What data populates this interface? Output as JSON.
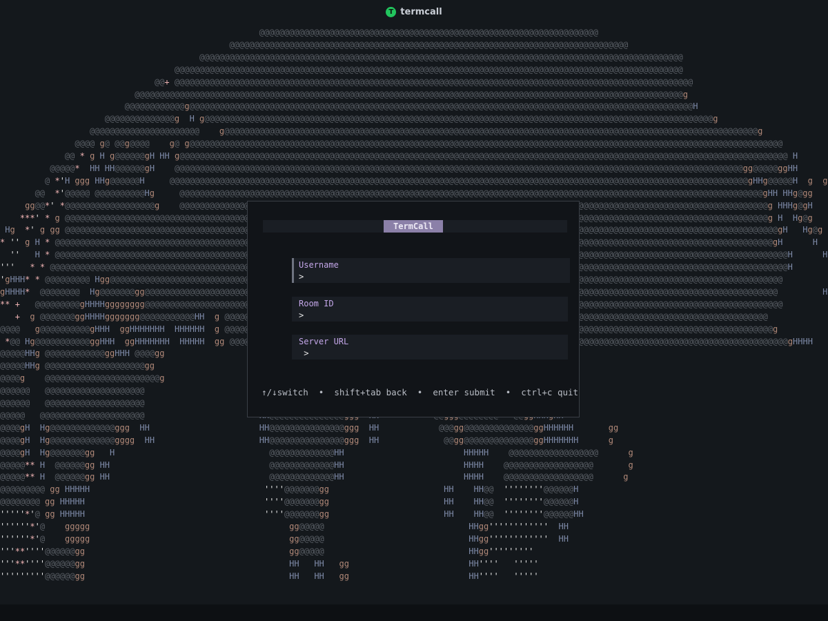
{
  "window": {
    "title": "termcall",
    "logo_letter": "T"
  },
  "colors": {
    "logo": "#22c55e",
    "title_badge": "#8b80a8",
    "field_label": "#c3a6e8",
    "art_at": "#5a5f66",
    "art_g": "#b08878",
    "art_h": "#7e8aa8"
  },
  "dialog": {
    "title": "TermCall",
    "fields": [
      {
        "label": "Username",
        "value": ">",
        "active": true
      },
      {
        "label": "Room ID",
        "value": ">",
        "active": false
      },
      {
        "label": "Server URL",
        "value": " >",
        "active": false
      }
    ],
    "help": "↑/↓switch  •  shift+tab back  •  enter submit  •  ctrl+c quit"
  },
  "background_art": {
    "description_visible": "ASCII art backdrop rendered in @ g H w ' , * + characters",
    "rows": [
      "                                                    @@@@@@@@@@@@@@@@@@@@@@@@@@@@@@@@@@@@@@@@@@@@@@@@@@@@@@@@@@@@@@@@@@@@",
      "                                              @@@@@@@@@@@@@@@@@@@@@@@@@@@@@@@@@@@@@@@@@@@@@@@@@@@@@@@@@@@@@@@@@@@@@@@@@@@@@@@@",
      "                                        @@@@@@@@@@@@@@@@@@@@@@@@@@@@@@@@@@@@@@@@@@@@@@@@@@@@@@@@@@@@@@@@@@@@@@@@@@@@@@@@@@@@@@@@@@@@@@@@@",
      "                                   @@@@@@@@@@@@@@@@@@@@@@@@@@@@@@@@@@@@@@@@@@@@@@@@@@@@@@@@@@@@@@@@@@@@@@@@@@@@@@@@@@@@@@@@@@@@@@@@@@@@@@",
      "                               @@+ @@@@@@@@@@@@@@@@@@@@@@@@@@@@@@@@@@@@@@@@@@@@@@@@@@@@@@@@@@@@@@@@@@@@@@@@@@@@@@@@@@@@@@@@@@@@@@@@@@@@@@@@",
      "                           @@@@@@@@@@@@@@@@@@@@@@@@@@@@@@@@@@@@@@@@@@@@@@@@@@@@@@@@@@@@@@@@@@@@@@@@@@@@@@@@@@@@@@@@@@@@@@@@@@@@@@@@@@@@@@g",
      "                         @@@@@@@@@@@@g@@@@@@@@@@@@@@@@@@@@@@@@@@@@@@@@@@@@@@@@@@@@@@@@@@@@@@@@@@@@@@@@@@@@@@@@@@@@@@@@@@@@@@@@@@@@@@@@@@@@@H",
      "                     @@@@@@@@@@@@@@g  H g@@@@@@@@@@@@@@@@@@@@@@@@@@@@@@@@@@@@@@@@@@@@@@@@@@@@@@@@@@@@@@@@@@@@@@@@@@@@@@@@@@@@@@@@@@@@@@@@@@@@@@g",
      "                  @@@@@@@@@@@@@@@@@@@@@@    g@@@@@@@@@@@@@@@@@@@@@@@@@@@@@@@@@@@@@@@@@@@@@@@@@@@@@@@@@@@@@@@@@@@@@@@@@@@@@@@@@@@@@@@@@@@@@@@@@@@@@@@@@@@g",
      "               @@@@ g@ @@g@@@@    g@ g@@@@@@@@@@@@@@@@@@@@@@@@@@@@@@@@@@@@@@@@@@@@@@@@@@@@@@@@@@@@@@@@@@@@@@@@@@@@@@@@@@@@@@@@@@@@@@@@@@@@@@@@@@@@@@@@@@@@@@@",
      "             @@ * g H g@@@@@@gH HH g@@@@@@@@@@@@@@@@@@@@@@@@@@@@@@@@@@@@@@@@@@@@@@@@@@@@@@@@@@@@@@@@@@@@@@@@@@@@@@@@@@@@@@@@@@@@@@@@@@@@@@@@@@@@@@@@@@@@@@@@@@ H",
      "          @@@@@*  HH HH@@@@@@gH    @@@@@@@@@@@@@@@@@@@@@@@@@@@@@@@@@@@@@@@@@@@@@@@@@@@@@@@@@@@@@@@@@@@@@@@@@@@@@@@@@@@@@@@@@@@@@@@@@@@@@@@@@@@@@@@@@@gg@@@@@ggHH",
      "         @ *'H ggg HHg@@@@@@H     @@@@@@@@@@@@@@@@@@@@@@@@@@@@@@@@@@@@@@@@@@@@@@@@@@@@@@@@@@@@@@@@@@@@@@@@@@@@@@@@@@@@@@@@@@@@@@@@@@@@@@@@@@@@@@@@@@@@gHHg@@@@@H  g  g",
      "       @@  *'@@@@@ @@@@@@@@@@Hg     @@@@@@@@@@@@@@@@@@@@@@@@@@@@@@@@@@@@@@@@@@@@@@@@@@@@@@@@@@@@@@@@@@@@@@@@@@@@@@@@@@@@@@@@@@@@@@@@@@@@@@@@@@@@@@@@@@@@@gHH HHg@gg    H",
      "     gg@@*' *@@@@@@@@@@@@@@@@@@g    @@@@@@@@@@@@@@@@@@@@@@@@@@@@@@@@@@@@@@@@@@@@@@@@@@@@@@@@@@@@@@@@@@@@@@@@@@@@@@@@@@@@@@@@@@@@@@@@@@@@@@@@@@@@@@@@@@@@@@g HHHg@gH     gHH",
      "    ***' * g @@@@@@@@@@@@@@@@@@@@@@@@@@@@@@@@@@@@@@@@@@@@@@@@@@@@@@@@@@@@@@@@@@@@@@@@@@@@@@@@@@@@@@@@@@@@@@@@@@@@@@@@@@@@@@@@@@@@@@@@@@@@@@@@@@@@@@@@@@@@@g H  Hg@g      H",
      " Hg  *' g gg @@@@@@@@@@@@@@@@@@@@@@@@@@@@@@@@@@@@@@@@@@@@@@@@@@@@@@@@@@@@@@@@@@@@@@@@@@@@@@@@@@@@@@@@@@@@@@@@@@@@@@@@@@@@@@@@@@@@@@@@@@@@@@@@@@@@@@@@@@@@@@@gH   Hg@g  HH  H",
      "* '' g H * @@@@@@@@@@@@@@@@@@@@@@@@@@@@@@@@@@@@@@@@@@@@@@@@@@@@@@@@@@@@@@@@@@@@@@@@@@@@@@@@@@@@@@@@@@@@@@@@@@@@@@@@@@@@@@@@@@@@@@@@@@@@@@@@@@@@@@@@@@@@@@@@gH      H  HHg@",
      "  ''   H * @@@@@@@@@@@@@@@@@@@@@@@@@@@@@@@@@@@@@@@@@@@@@@@@@@@@@@@@@@@@@@@@@@@@@@@@@@@@@@@@@@@@@@@@@@@@@@@@@@@@@@@@@@@@@@@@@@@@@@@@@@@@@@@@@@@@@@@@@@@@@@@@@@@H      H ggg @",
      "'''   * * @@@@@@@@@@@@@@@@@@@@@@@@@@@@@@@@@@@@@@@@@@@@@@@@@@@@@@@@@@@@@@@@@@@@@@@@@@@@@@@@@@@@@@@@@@@@@@@@@@@@@@@@@@@@@@@@@@@@@@@@@@@@@@@@@@@@@@@@@@@@@@@@@@@@H         g g H",
      "'gHHH* * @@@@@@@@@ Hgg@@@@@@@@@@@@@@@@@@@@@@@@@@@@@@@@@@@@@@@@@@@@@@@@@@@@@@@@@@@@@@@@@@@@@@@@@@@@@@@@@@@@@@@@@@@@@@@@@@@@@@@@@@@@@@@@@@@@@@@@@@@@@@@@@@@@@@@",
      "gHHHH*  @@@@@@@@  Hg@@@@@@@gg@@@@@@@@@@@@@@@@@@@@@@@@@@@@@@@@@@@@@@@@@@@@@@@@@@@@@@@@@@@@@@@@@@@@@@@@@@@@@@@@@@@@@@@@@@@@@@@@@@@@@@@@@@@@@@@@@@@@@@@@@@@@@@@         H",
      "** +   @@@@@@@@@gHHHHgggggggg@@@@@@@@@@@@@@@@@@@@@@@@@@@@@@@@@@@@@@@@@@@@@@@@@@@@@@@@@@@@@@@@@@@@@@@@@@@@@@@@@@@@@@@@@@@@@@@@@@@@@@@@@@@@@@@@@@@@@@@@@@@@@@@@",
      "   +  g @@@@@@@ggHHHHggggggg@@@@@@@@@@@HH  g @@@@@@@@@@@@@@@@@@@@@@@@@@@@@@@@@@@@@@@@@@@@@@@@@@@@@@@@@@@@@@@@@@@@@@@@@@@@@@@@@@@@@@@@@@@@@@@@@@@@@@@@@@@@@",
      "@@@@   g@@@@@@@@@@gHHH  ggHHHHHHH  HHHHHH  g @@@@@@@@@@@@@@@@@@@@@@@@@@@@@@@@@@@@@@@@@@@@@@@@@@@@@@@@@@@@@@@@@@@@@@@@@@@@@@@@@@@@@@@@@@@@@@@@@@@@@@@@@@@@@@g",
      " *@@ Hg@@@@@@@@@@@ggHHH  ggHHHHHHH  HHHHH  gg @@@@@@@@@@@@@@@@@@@@@@@@@@@@@@@@@@@@@@@@@@@@@@@@@@@@@@@@@@@@@@@@@@@@@@@@@@@@@@@@@@@@@@@@@@@@@@@@@@@@@@@@@@@@@@@@gHHHH",
      "@@@@@HHg @@@@@@@@@@@@ggHHH @@@@gg                                                            g@@@@@@@@@@@gHHHH",
      "@@@@@HHg @@@@@@@@@@@@@@@@@@@@gg                                                                gg@ggggg   HH",
      "@@@@g    @@@@@@@@@@@@@@@@@@@@@@@g                                                             gg@gggg    HH",
      "@@@@@@   @@@@@@@@@@@@@@@@@@@@                                                                HHggHH",
      "@@@@@@   @@@@@@@@@@@@@@@@@@@@                                                                 HHggHH",
      "@@@@@   @@@@@@@@@@@@@@@@@@@@@                       HH@@@@@@@@@@@@@@@ggg  HH           @@ggg@@@@@@@@'''@@ggHHHgHH",
      "@@@@gH  Hg@@@@@@@@@@@@@ggg  HH                      HH@@@@@@@@@@@@@@@ggg  HH            @@@gg@@@@@@@@@@@@@@ggHHHHHH       gg",
      "@@@@gH  Hg@@@@@@@@@@@@@gggg  HH                     HH@@@@@@@@@@@@@@@ggg  HH             @@gg@@@@@@@@@@@@@@ggHHHHHHH      g",
      "@@@@gH  Hg@@@@@@@gg   H                               @@@@@@@@@@@@@HH                        HHHHH    @@@@@@@@@@@@@@@@@@      g",
      "@@@@@** H  @@@@@@gg HH                                @@@@@@@@@@@@@HH                        HHHH    @@@@@@@@@@@@@@@@@@       g",
      "@@@@@** H  @@@@@@gg HH                                @@@@@@@@@@@@@HH                        HHHH    @@@@@@@@@@@@@@@@@@      g",
      "@@@@@@@@@ gg HHHHH                                   ''''@@@@@@@gg                       HH    HH@@  ''''''''@@@@@@H",
      "@@@@@@@@ gg HHHHH                                    ''''@@@@@@@gg                       HH    HH@@  ''''''''@@@@@@H",
      "'''''*'@ gg HHHHH                                    ''''@@@@@@@gg                       HH    HH@@  ''''''''@@@@@@HH",
      "''''''*'@    ggggg                                        gg@@@@@                             HHgg''''''''''''  HH",
      "''''''*'@    ggggg                                        gg@@@@@                             HHgg''''''''''''  HH",
      "'''**''''@@@@@@gg                                         gg@@@@@                             HHgg'''''''''",
      "'''**''''@@@@@@gg                                         HH   HH   gg                        HH''''   '''''",
      "'''''''''@@@@@@gg                                         HH   HH   gg                        HH''''   '''''"
    ]
  }
}
